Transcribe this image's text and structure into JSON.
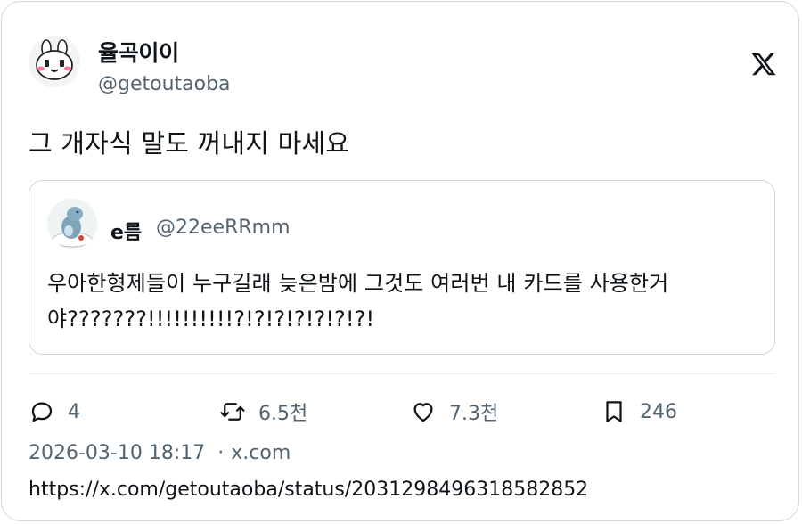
{
  "author": {
    "name": "율곡이이",
    "handle": "@getoutaoba",
    "avatar_icon": "cartoon-bunny-avatar"
  },
  "brand_icon": "x-logo-icon",
  "tweet": {
    "text": "그 개자식 말도 꺼내지 마세요"
  },
  "quoted": {
    "name": "e름",
    "handle": "@22eeRRmm",
    "avatar_icon": "figurine-avatar",
    "text": "우아한형제들이 누구길래 늦은밤에 그것도 여러번 내 카드를 사용한거야???????!!!!!!!!!!?!?!?!?!?!?!?!"
  },
  "actions": {
    "replies": "4",
    "reposts": "6.5천",
    "likes": "7.3천",
    "bookmarks": "246"
  },
  "meta": {
    "timestamp": "2026-03-10 18:17",
    "separator": "·",
    "source": "x.com"
  },
  "url": "https://x.com/getoutaoba/status/2031298496318582852",
  "colors": {
    "text": "#0f1419",
    "secondary": "#536471",
    "border": "#cfd9de"
  }
}
